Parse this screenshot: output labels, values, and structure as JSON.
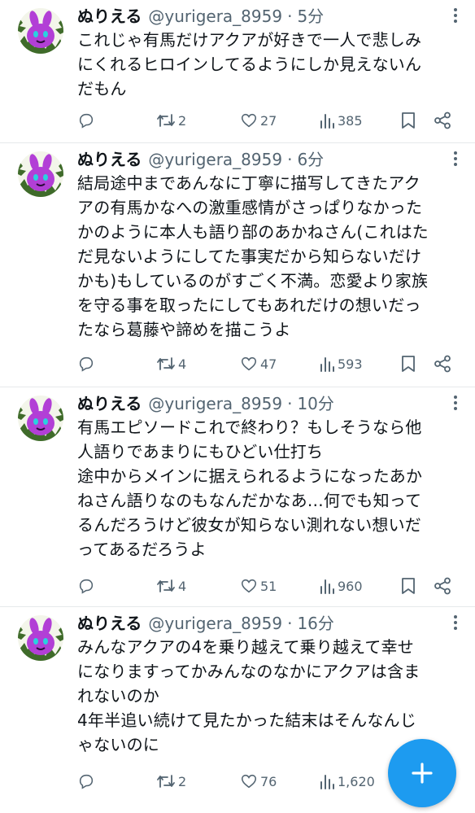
{
  "tweets": [
    {
      "name": "ぬりえる",
      "handle": "@yurigera_8959",
      "separator": "·",
      "time": "5分",
      "text": "これじゃ有馬だけアクアが好きで一人で悲しみ\nにくれるヒロインしてるようにしか見えないん\nだもん",
      "retweets": "2",
      "likes": "27",
      "views": "385"
    },
    {
      "name": "ぬりえる",
      "handle": "@yurigera_8959",
      "separator": "·",
      "time": "6分",
      "text": "結局途中まであんなに丁寧に描写してきたアク\nアの有馬かなへの激重感情がさっぱりなかった\nかのように本人も語り部のあかねさん(これはた\nだ見ないようにしてた事実だから知らないだけ\nかも)もしているのがすごく不満。恋愛より家族\nを守る事を取ったにしてもあれだけの想いだっ\nたなら葛藤や諦めを描こうよ",
      "retweets": "4",
      "likes": "47",
      "views": "593"
    },
    {
      "name": "ぬりえる",
      "handle": "@yurigera_8959",
      "separator": "·",
      "time": "10分",
      "text": "有馬エピソードこれで終わり？もしそうなら他\n人語りであまりにもひどい仕打ち\n途中からメインに据えられるようになったあか\nねさん語りなのもなんだかなあ…何でも知って\nるんだろうけど彼女が知らない測れない想いだ\nってあるだろうよ",
      "retweets": "4",
      "likes": "51",
      "views": "960"
    },
    {
      "name": "ぬりえる",
      "handle": "@yurigera_8959",
      "separator": "·",
      "time": "16分",
      "text": "みんなアクアの4を乗り越えて乗り越えて幸せ\nになりますってかみんなのなかにアクアは含ま\nれないのか\n4年半追い続けて見たかった結末はそんなんじ\nゃないのに",
      "retweets": "2",
      "likes": "76",
      "views": "1,620"
    }
  ],
  "icons": {
    "reply": "reply-icon",
    "retweet": "retweet-icon",
    "like": "heart-icon",
    "views": "views-icon",
    "bookmark": "bookmark-icon",
    "share": "share-icon",
    "compose": "plus-icon"
  },
  "colors": {
    "accent": "#1d9bf0",
    "text": "#0f1419",
    "secondary": "#536471"
  }
}
